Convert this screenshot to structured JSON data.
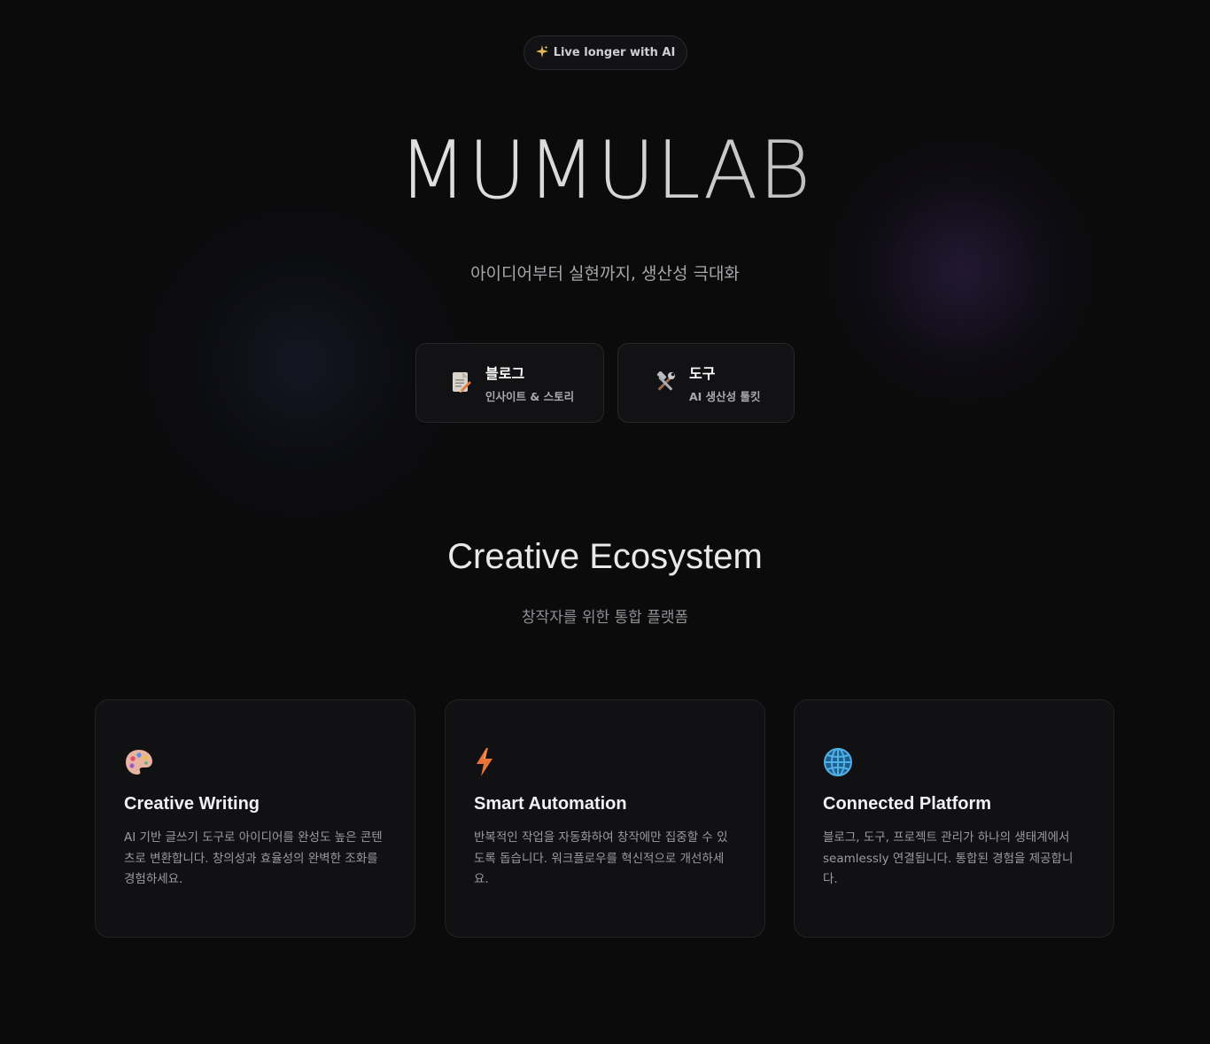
{
  "badge": {
    "icon": "sparkles-icon",
    "label": "Live longer with AI"
  },
  "hero": {
    "title": "MUMULAB",
    "subtitle": "아이디어부터 실현까지, 생산성 극대화"
  },
  "nav_cards": [
    {
      "icon": "memo-pencil-icon",
      "title": "블로그",
      "description": "인사이트 & 스토리"
    },
    {
      "icon": "hammer-wrench-icon",
      "title": "도구",
      "description": "AI 생산성 툴킷"
    }
  ],
  "section": {
    "title": "Creative Ecosystem",
    "subtitle": "창작자를 위한 통합 플랫폼"
  },
  "features": [
    {
      "icon": "palette-icon",
      "title": "Creative Writing",
      "description": "AI 기반 글쓰기 도구로 아이디어를 완성도 높은 콘텐츠로 변환합니다. 창의성과 효율성의 완벽한 조화를 경험하세요."
    },
    {
      "icon": "lightning-icon",
      "title": "Smart Automation",
      "description": "반복적인 작업을 자동화하여 창작에만 집중할 수 있도록 돕습니다. 워크플로우를 혁신적으로 개선하세요."
    },
    {
      "icon": "globe-icon",
      "title": "Connected Platform",
      "description": "블로그, 도구, 프로젝트 관리가 하나의 생태계에서 seamlessly 연결됩니다. 통합된 경험을 제공합니다."
    }
  ],
  "colors": {
    "background": "#0b0b0c",
    "card": "#111113",
    "accent_purple": "#46306e"
  }
}
